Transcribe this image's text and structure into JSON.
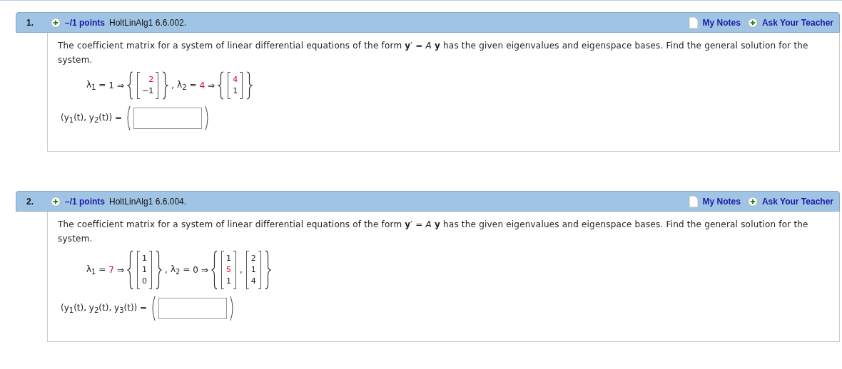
{
  "questions": [
    {
      "number": "1.",
      "points": "–/1 points",
      "source": "HoltLinAlg1 6.6.002.",
      "notes": "My Notes",
      "ask": "Ask Your Teacher",
      "prompt": "The coefficient matrix for a system of linear differential equations of the form **y**′ = *A* **y** has the given eigenvalues and eigenspace bases. Find the general solution for the system.",
      "eigen": [
        {
          "label": "λ$_{1}$ =",
          "value": {
            "text": "1",
            "highlight": false
          },
          "arrow": "⇒",
          "vectors": [
            [
              {
                "text": "2",
                "highlight": true
              },
              {
                "text": "−1",
                "highlight": false
              }
            ]
          ],
          "after": ","
        },
        {
          "label": "λ$_{2}$ =",
          "value": {
            "text": "4",
            "highlight": true
          },
          "arrow": "⇒",
          "vectors": [
            [
              {
                "text": "4",
                "highlight": true
              },
              {
                "text": "1",
                "highlight": false
              }
            ]
          ]
        }
      ],
      "answer_label": "(y$_{1}$(t), y$_{2}$(t)) ="
    },
    {
      "number": "2.",
      "points": "–/1 points",
      "source": "HoltLinAlg1 6.6.004.",
      "notes": "My Notes",
      "ask": "Ask Your Teacher",
      "prompt": "The coefficient matrix for a system of linear differential equations of the form **y**′ = *A* **y** has the given eigenvalues and eigenspace bases. Find the general solution for the system.",
      "eigen": [
        {
          "label": "λ$_{1}$ =",
          "value": {
            "text": "7",
            "highlight": true
          },
          "arrow": "⇒",
          "vectors": [
            [
              {
                "text": "1",
                "highlight": false
              },
              {
                "text": "1",
                "highlight": false
              },
              {
                "text": "0",
                "highlight": false
              }
            ]
          ],
          "after": ","
        },
        {
          "label": "λ$_{2}$ =",
          "value": {
            "text": "0",
            "highlight": false
          },
          "arrow": "⇒",
          "vectors": [
            [
              {
                "text": "1",
                "highlight": false
              },
              {
                "text": "5",
                "highlight": true
              },
              {
                "text": "1",
                "highlight": false
              }
            ],
            [
              {
                "text": "2",
                "highlight": false
              },
              {
                "text": "1",
                "highlight": false
              },
              {
                "text": "4",
                "highlight": false
              }
            ]
          ],
          "vector_separator": ","
        }
      ],
      "answer_label": "(y$_{1}$(t), y$_{2}$(t), y$_{3}$(t)) ="
    }
  ]
}
